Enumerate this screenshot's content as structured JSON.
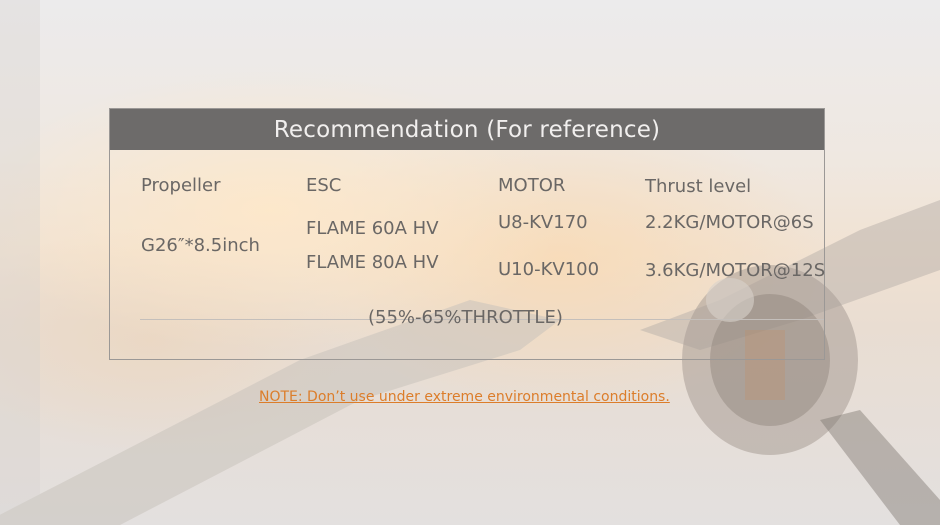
{
  "header": {
    "title": "Recommendation (For reference)"
  },
  "columns": {
    "propeller": "Propeller",
    "esc": "ESC",
    "motor": "MOTOR",
    "thrust": "Thrust level"
  },
  "propeller": {
    "value": "G26″*8.5inch"
  },
  "esc": {
    "items": [
      "FLAME 60A HV",
      "FLAME 80A HV"
    ]
  },
  "motor": {
    "items": [
      "U8-KV170",
      "U10-KV100"
    ]
  },
  "thrust": {
    "items": [
      "2.2KG/MOTOR@6S",
      "3.6KG/MOTOR@12S"
    ]
  },
  "throttle": {
    "label": "(55%-65%THROTTLE)"
  },
  "note": {
    "text": "NOTE: Don’t use under extreme environmental conditions."
  },
  "colors": {
    "header_bg": "#6d6b6a",
    "note": "#dc7d2a",
    "text": "#6a6765"
  }
}
